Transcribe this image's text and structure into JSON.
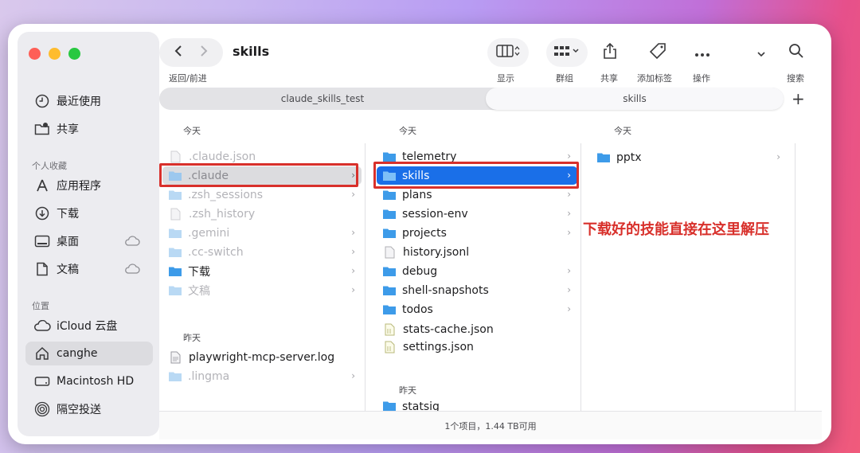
{
  "window": {
    "title": "skills"
  },
  "toolbar": {
    "back_forward_label": "返回/前进",
    "view_label": "显示",
    "group_label": "群组",
    "share_label": "共享",
    "tags_label": "添加标签",
    "action_label": "操作",
    "search_label": "搜索"
  },
  "tabs": [
    {
      "label": "claude_skills_test"
    },
    {
      "label": "skills"
    }
  ],
  "sidebar": {
    "recents": "最近使用",
    "shared": "共享",
    "favorites_header": "个人收藏",
    "favorites": [
      "应用程序",
      "下载",
      "桌面",
      "文稿"
    ],
    "locations_header": "位置",
    "locations": [
      "iCloud 云盘",
      "canghe",
      "Macintosh HD",
      "隔空投送"
    ]
  },
  "column1": {
    "header_today": "今天",
    "items": [
      ".claude.json",
      ".claude",
      ".zsh_sessions",
      ".zsh_history",
      ".gemini",
      ".cc-switch",
      "下载",
      "文稿"
    ],
    "header_yesterday": "昨天",
    "items_yesterday": [
      "playwright-mcp-server.log",
      ".lingma"
    ]
  },
  "column2": {
    "header_today": "今天",
    "items": [
      "telemetry",
      "skills",
      "plans",
      "session-env",
      "projects",
      "history.jsonl",
      "debug",
      "shell-snapshots",
      "todos",
      "stats-cache.json",
      "settings.json"
    ],
    "header_yesterday": "昨天",
    "items_yesterday": [
      "statsig"
    ]
  },
  "column3": {
    "header_today": "今天",
    "items": [
      "pptx"
    ]
  },
  "annotation": "下载好的技能直接在这里解压",
  "status": "1个项目，1.44 TB可用",
  "colors": {
    "selection": "#1a6fe8",
    "annotation": "#d8302b",
    "folder": "#3d9be9"
  }
}
